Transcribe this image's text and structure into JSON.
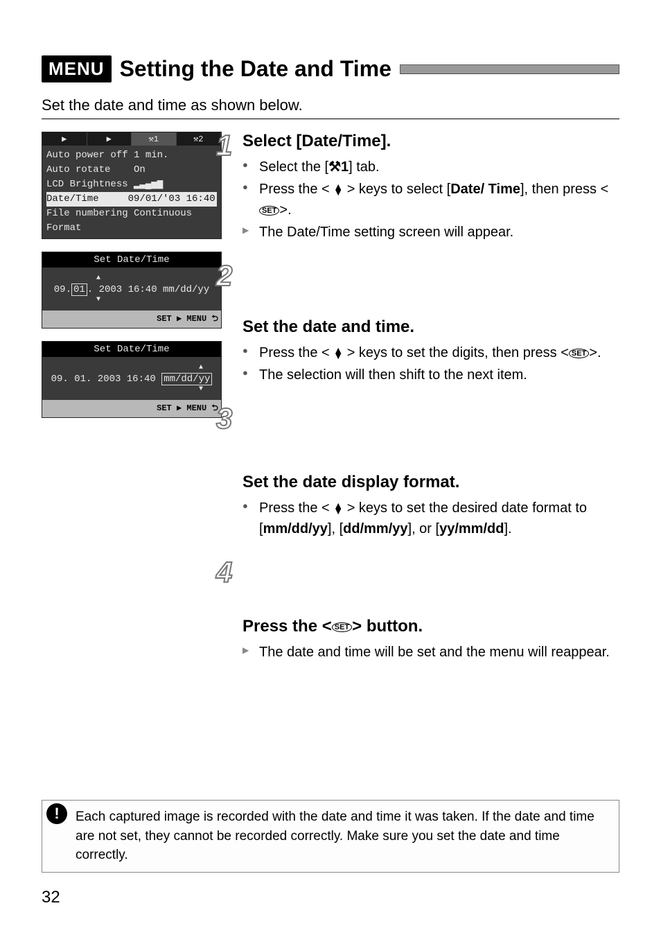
{
  "header": {
    "badge": "MENU",
    "title": "Setting the Date and Time"
  },
  "intro": "Set the date and time as shown below.",
  "lcd_menu": {
    "tabs": [
      "▶",
      "▶",
      "⚒1",
      "⚒2"
    ],
    "selected_tab_index": 2,
    "rows": [
      "Auto power off 1 min.",
      "Auto rotate    On",
      "LCD Brightness ▂▃▄▅▆",
      "Date/Time     09/01/'03 16:40",
      "File numbering Continuous",
      "Format"
    ],
    "selected_row_index": 3
  },
  "lcd_set1": {
    "title": "Set Date/Time",
    "line_parts": {
      "pre": "09.",
      "boxed": "01",
      "post": ". 2003  16:40  mm/dd/yy"
    },
    "footer": "SET ▶ MENU ⮌"
  },
  "lcd_set2": {
    "title": "Set Date/Time",
    "line_parts": {
      "pre": "09. 01. 2003  16:40  ",
      "boxed": "mm/dd/yy",
      "post": ""
    },
    "footer": "SET ▶ MENU ⮌"
  },
  "steps": [
    {
      "num": "1",
      "head": "Select [Date/Time].",
      "bullets": [
        {
          "type": "action",
          "html": "Select the [<b class='wrench'>⚒1</b>] tab."
        },
        {
          "type": "action",
          "html": "Press the &lt; <span class='updown'>▲<br>▼</span> &gt; keys to select [<b>Date/ Time</b>], then press &lt;<span class='set-icon'>SET</span>&gt;."
        },
        {
          "type": "result",
          "html": "The Date/Time setting screen will appear."
        }
      ]
    },
    {
      "num": "2",
      "head": "Set the date and time.",
      "bullets": [
        {
          "type": "action",
          "html": "Press the &lt; <span class='updown'>▲<br>▼</span> &gt; keys to set the digits, then press &lt;<span class='set-icon'>SET</span>&gt;."
        },
        {
          "type": "action",
          "html": "The selection will then shift to the next item."
        }
      ]
    },
    {
      "num": "3",
      "head": "Set the date display format.",
      "bullets": [
        {
          "type": "action",
          "html": "Press the &lt; <span class='updown'>▲<br>▼</span> &gt; keys to set the desired date format to [<b>mm/dd/yy</b>], [<b>dd/mm/yy</b>], or [<b>yy/mm/dd</b>]."
        }
      ]
    },
    {
      "num": "4",
      "head_html": "Press the &lt;<span class='set-icon'>SET</span>&gt; button.",
      "bullets": [
        {
          "type": "result",
          "html": "The date and time will be set and the menu will reappear."
        }
      ]
    }
  ],
  "caution": "Each captured image is recorded with the date and time it was taken. If the date and time are not set, they cannot be recorded correctly. Make sure you set the date and time correctly.",
  "page_number": "32"
}
